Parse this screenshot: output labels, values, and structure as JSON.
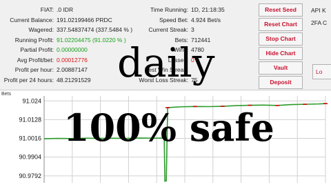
{
  "stats": {
    "left": [
      {
        "label": "FIAT:",
        "value": ".0 IDR",
        "color": "normal"
      },
      {
        "label": "Current Balance:",
        "value": "191.02199466 PRDC",
        "color": "normal"
      },
      {
        "label": "Wagered:",
        "value": "337.54837474 (337.5484 % )",
        "color": "normal"
      },
      {
        "label": "Running Profit:",
        "value": "91.02204475 (91.0220 % )",
        "color": "green"
      },
      {
        "label": "Partial Profit:",
        "value": "0.00000000",
        "color": "green"
      },
      {
        "label": "Avg Profit/bet:",
        "value": "0.00012776",
        "color": "red"
      },
      {
        "label": "Profit per hour:",
        "value": "2.00887147",
        "color": "normal"
      },
      {
        "label": "Profit per 24 hours:",
        "value": "48.21291529",
        "color": "normal"
      }
    ],
    "right": [
      {
        "label": "Time Running:",
        "value": "1D, 21:18:35",
        "color": "normal"
      },
      {
        "label": "Speed Bet:",
        "value": "4.924 Bet/s",
        "color": "normal"
      },
      {
        "label": "Current Streak:",
        "value": "3",
        "color": "normal"
      },
      {
        "label": "Bets:",
        "value": "712441",
        "color": "normal"
      },
      {
        "label": "Wins:",
        "value": "4780",
        "color": "normal"
      },
      {
        "label": "Losses:",
        "value": "0",
        "color": "red"
      },
      {
        "label": "Best Win Streak:",
        "value": "",
        "color": "normal"
      },
      {
        "label": "Worst Loss Streak:",
        "value": "75",
        "color": "normal"
      }
    ]
  },
  "buttons": [
    "Reset Seed",
    "Reset Chart",
    "Stop Chart",
    "Hide Chart",
    "Vault",
    "Deposit"
  ],
  "right_panel": {
    "line1": "API K",
    "line2": "2FA C",
    "button": "Lo"
  },
  "overlay": {
    "top": "daily",
    "bottom": "100% safe"
  },
  "chart_data": {
    "type": "line",
    "title": "Bets",
    "y_ticks": [
      "91.024",
      "91.0128",
      "91.0016",
      "90.9904",
      "90.9792"
    ],
    "ylim": [
      90.975,
      91.027
    ],
    "series": [
      {
        "color": "#2a9a2a",
        "values": [
          [
            0,
            91.0014
          ],
          [
            20,
            91.0016
          ],
          [
            40,
            91.0015
          ],
          [
            60,
            91.0017
          ],
          [
            80,
            91.0016
          ],
          [
            100,
            91.0017
          ],
          [
            120,
            91.0016
          ],
          [
            140,
            91.0018
          ],
          [
            160,
            91.0017
          ],
          [
            175,
            91.0018
          ],
          [
            176,
            90.976
          ],
          [
            178,
            90.9762
          ],
          [
            180,
            91.02
          ],
          [
            200,
            91.0205
          ],
          [
            220,
            91.0207
          ],
          [
            240,
            91.0206
          ],
          [
            260,
            91.0208
          ],
          [
            280,
            91.0212
          ],
          [
            300,
            91.0214
          ],
          [
            320,
            91.0215
          ],
          [
            340,
            91.0213
          ],
          [
            360,
            91.0218
          ],
          [
            380,
            91.022
          ],
          [
            400,
            91.0222
          ],
          [
            410,
            91.0224
          ]
        ]
      }
    ],
    "accent": "#cc0000",
    "grid": true
  }
}
